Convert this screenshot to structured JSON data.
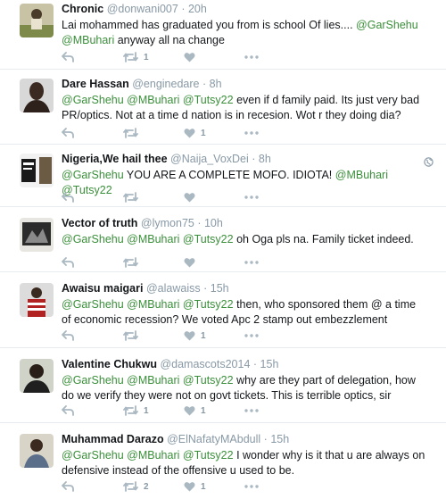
{
  "tweets": [
    {
      "name": "Chronic",
      "handle": "@donwani007",
      "time": "20h",
      "parts": [
        {
          "t": "Lai mohammed has graduated you from is school Of lies.... "
        },
        {
          "t": "@GarShehu",
          "m": true
        },
        {
          "t": " "
        },
        {
          "t": "@MBuhari",
          "m": true
        },
        {
          "t": " anyway all na change"
        }
      ],
      "retweets": "1",
      "likes": ""
    },
    {
      "name": "Dare Hassan",
      "handle": "@enginedare",
      "time": "8h",
      "parts": [
        {
          "t": "@GarShehu",
          "m": true
        },
        {
          "t": " "
        },
        {
          "t": "@MBuhari",
          "m": true
        },
        {
          "t": " "
        },
        {
          "t": "@Tutsy22",
          "m": true
        },
        {
          "t": " even if d family paid. Its just very bad PR/optics. Not at a time d nation is in recesion. Wot r they doing dia?"
        }
      ],
      "retweets": "",
      "likes": "1"
    },
    {
      "name": "Nigeria,We hail thee",
      "handle": "@Naija_VoxDei",
      "time": "8h",
      "parts": [
        {
          "t": "@GarShehu",
          "m": true
        },
        {
          "t": " YOU ARE A COMPLETE MOFO. IDIOTA! "
        },
        {
          "t": "@MBuhari",
          "m": true
        },
        {
          "t": " "
        },
        {
          "t": "@Tutsy22",
          "m": true
        }
      ],
      "retweets": "",
      "likes": ""
    },
    {
      "name": "Vector of truth",
      "handle": "@lymon75",
      "time": "10h",
      "parts": [
        {
          "t": "@GarShehu",
          "m": true
        },
        {
          "t": " "
        },
        {
          "t": "@MBuhari",
          "m": true
        },
        {
          "t": " "
        },
        {
          "t": "@Tutsy22",
          "m": true
        },
        {
          "t": " oh Oga pls na. Family ticket indeed."
        }
      ],
      "retweets": "",
      "likes": ""
    },
    {
      "name": "Awaisu maigari",
      "handle": "@alawaiss",
      "time": "15h",
      "parts": [
        {
          "t": "@GarShehu",
          "m": true
        },
        {
          "t": " "
        },
        {
          "t": "@MBuhari",
          "m": true
        },
        {
          "t": " "
        },
        {
          "t": "@Tutsy22",
          "m": true
        },
        {
          "t": " then, who sponsored them @ a time of economic recession? We voted Apc 2 stamp out embezzlement"
        }
      ],
      "retweets": "",
      "likes": "1"
    },
    {
      "name": "Valentine Chukwu",
      "handle": "@damascots2014",
      "time": "15h",
      "parts": [
        {
          "t": "@GarShehu",
          "m": true
        },
        {
          "t": " "
        },
        {
          "t": "@MBuhari",
          "m": true
        },
        {
          "t": " "
        },
        {
          "t": "@Tutsy22",
          "m": true
        },
        {
          "t": " why are they part of delegation, how do we verify they were not on govt tickets. This is terrible optics, sir"
        }
      ],
      "retweets": "1",
      "likes": "1"
    },
    {
      "name": "Muhammad Darazo",
      "handle": "@ElNafatyMAbdull",
      "time": "15h",
      "parts": [
        {
          "t": "@GarShehu",
          "m": true
        },
        {
          "t": " "
        },
        {
          "t": "@MBuhari",
          "m": true
        },
        {
          "t": " "
        },
        {
          "t": "@Tutsy22",
          "m": true
        },
        {
          "t": " I wonder why is it that u are always on defensive instead of the offensive u used to be."
        }
      ],
      "retweets": "2",
      "likes": "1"
    }
  ],
  "icons": {
    "reply": "reply-icon",
    "retweet": "retweet-icon",
    "like": "heart-icon",
    "more": "more-icon",
    "globe": "globe-icon"
  },
  "colors": {
    "mention": "#3a8f3a",
    "action_icon": "#aab8c2",
    "handle": "#8899a6"
  }
}
